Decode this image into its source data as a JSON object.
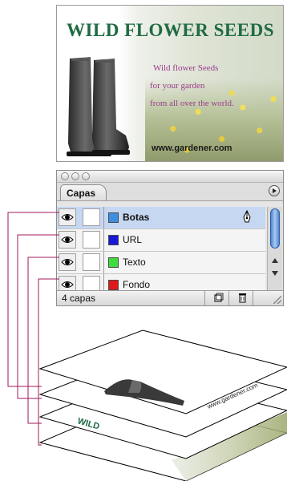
{
  "artwork": {
    "title": "WILD FLOWER SEEDS",
    "lines": [
      "Wild flower Seeds",
      "for your garden",
      "from all over the world."
    ],
    "url": "www.gardener.com"
  },
  "palette": {
    "tab_label": "Capas",
    "layers": [
      {
        "name": "Botas",
        "color": "#3d8ee0",
        "selected": true
      },
      {
        "name": "URL",
        "color": "#1818d8",
        "selected": false
      },
      {
        "name": "Texto",
        "color": "#3fdc3f",
        "selected": false
      },
      {
        "name": "Fondo",
        "color": "#e01818",
        "selected": false
      }
    ],
    "layer_count": "4 capas"
  },
  "stack": {
    "url_text": "www.gardener.com",
    "title_fragment": "WILD"
  },
  "colors": {
    "connector": "#a0185e",
    "title_green": "#1f6b43",
    "tagline_magenta": "#9a3d8c"
  },
  "icons": [
    "eye-icon",
    "pen-icon",
    "new-layer-icon",
    "trash-icon",
    "palette-menu-icon"
  ]
}
